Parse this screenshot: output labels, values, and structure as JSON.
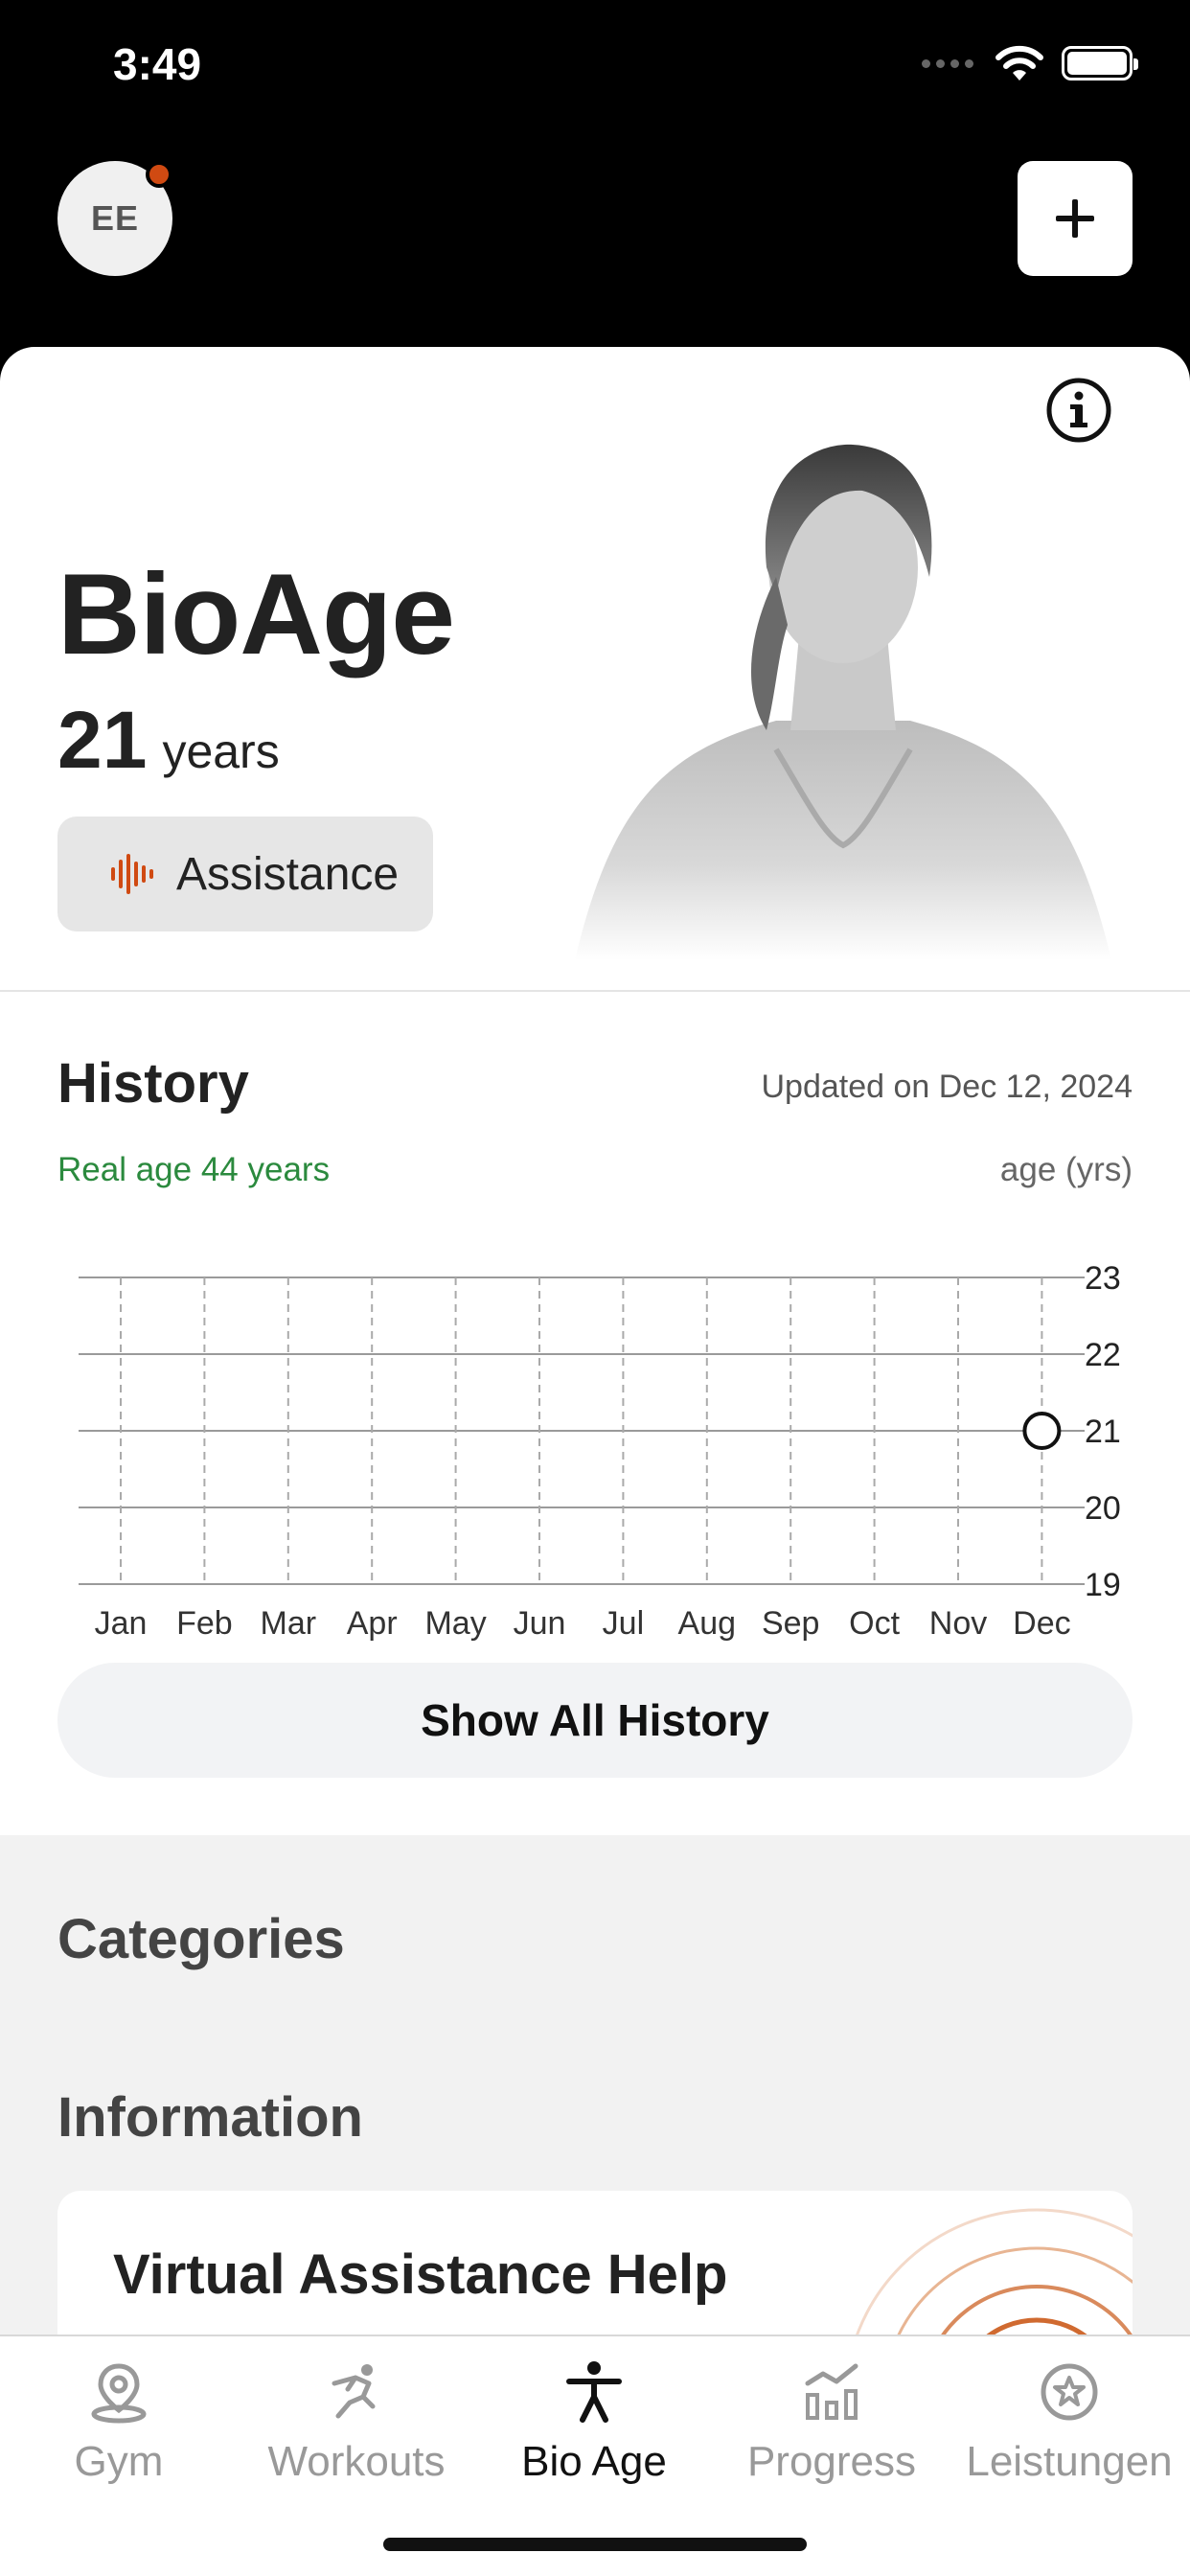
{
  "status_bar": {
    "time": "3:49"
  },
  "header": {
    "avatar_initials": "EE"
  },
  "hero": {
    "title": "BioAge",
    "age_value": "21",
    "age_unit": "years",
    "assistance_label": "Assistance"
  },
  "history": {
    "title": "History",
    "updated": "Updated on Dec 12, 2024",
    "real_age": "Real age 44 years",
    "unit_label": "age (yrs)",
    "show_all_label": "Show All History"
  },
  "chart_data": {
    "type": "scatter",
    "categories": [
      "Jan",
      "Feb",
      "Mar",
      "Apr",
      "May",
      "Jun",
      "Jul",
      "Aug",
      "Sep",
      "Oct",
      "Nov",
      "Dec"
    ],
    "y_ticks": [
      "23",
      "22",
      "21",
      "20",
      "19"
    ],
    "ylim": [
      19,
      23
    ],
    "points": [
      {
        "x": "Dec",
        "y": 21
      }
    ],
    "ylabel": "age (yrs)",
    "grid": true
  },
  "sections": {
    "categories_title": "Categories",
    "information_title": "Information",
    "info_card_title": "Virtual Assistance Help"
  },
  "tabs": [
    {
      "label": "Gym",
      "icon": "location-pin-icon"
    },
    {
      "label": "Workouts",
      "icon": "running-icon"
    },
    {
      "label": "Bio Age",
      "icon": "person-icon"
    },
    {
      "label": "Progress",
      "icon": "bar-chart-icon"
    },
    {
      "label": "Leistungen",
      "icon": "star-badge-icon"
    }
  ],
  "colors": {
    "accent": "#d04a12",
    "real_age_green": "#2b8a3e"
  }
}
